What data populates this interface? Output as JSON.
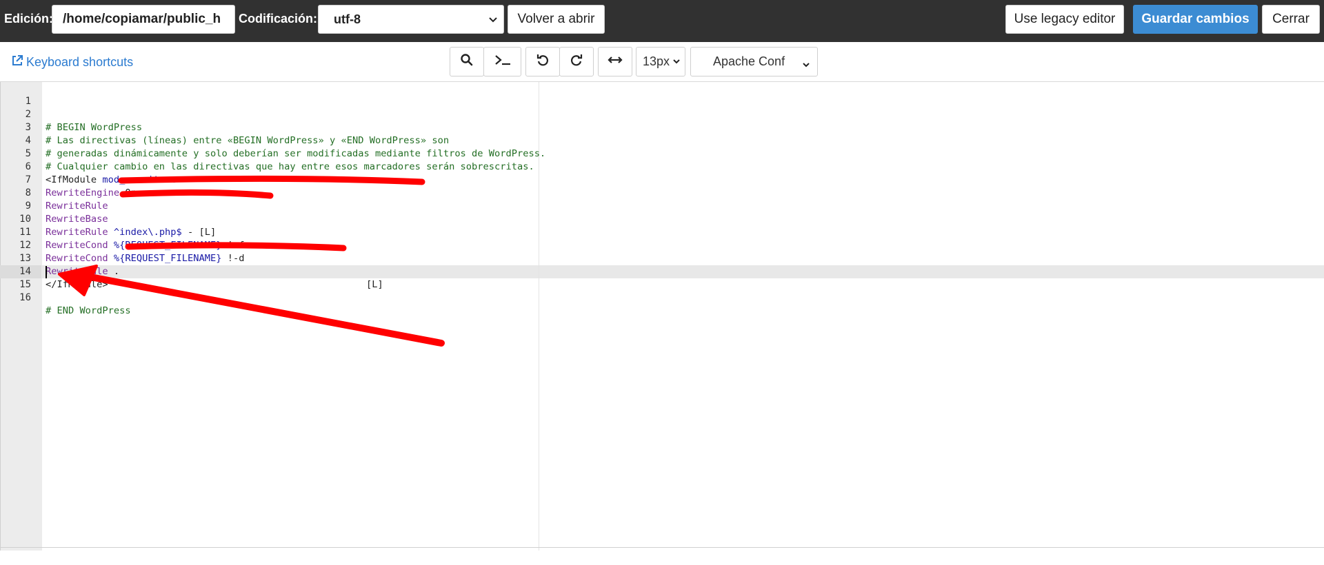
{
  "topbar": {
    "edit_label": "Edición:",
    "path_value": "/home/copiamar/public_h",
    "encoding_label": "Codificación:",
    "encoding_value": "utf-8",
    "reopen_label": "Volver a abrir",
    "legacy_label": "Use legacy editor",
    "save_label": "Guardar cambios",
    "close_label": "Cerrar"
  },
  "toolbar": {
    "shortcuts_label": "Keyboard shortcuts",
    "font_size": "13px",
    "mode": "Apache Conf",
    "icons": [
      "search-icon",
      "terminal-icon",
      "undo-icon",
      "redo-icon",
      "wrap-icon"
    ]
  },
  "editor": {
    "active_line": 15,
    "lines": [
      {
        "n": "1"
      },
      {
        "n": "2",
        "comment": "# BEGIN WordPress"
      },
      {
        "n": "3",
        "comment": "# Las directivas (líneas) entre «BEGIN WordPress» y «END WordPress» son"
      },
      {
        "n": "4",
        "comment": "# generadas dinámicamente y solo deberían ser modificadas mediante filtros de WordPress."
      },
      {
        "n": "5",
        "comment": "# Cualquier cambio en las directivas que hay entre esos marcadores serán sobrescritas."
      },
      {
        "n": "6",
        "tag": "<IfModule ",
        "val": "mod_rewrite.c",
        "tag2": ">"
      },
      {
        "n": "7",
        "key": "RewriteEngine",
        "rest": " On"
      },
      {
        "n": "8",
        "key": "RewriteRule",
        "rest": ""
      },
      {
        "n": "9",
        "key": "RewriteBase",
        "rest": ""
      },
      {
        "n": "10",
        "key": "RewriteRule",
        "val": " ^index\\.php$",
        "rest": " - [L]"
      },
      {
        "n": "11",
        "key": "RewriteCond",
        "val": " %{REQUEST_FILENAME}",
        "rest": " !-f"
      },
      {
        "n": "12",
        "key": "RewriteCond",
        "val": " %{REQUEST_FILENAME}",
        "rest": " !-d"
      },
      {
        "n": "13",
        "key": "RewriteRule",
        "rest": " .",
        "tail": "[L]"
      },
      {
        "n": "14",
        "tag": "</IfModule>"
      },
      {
        "n": "15"
      },
      {
        "n": "16",
        "comment": "# END WordPress"
      }
    ]
  }
}
